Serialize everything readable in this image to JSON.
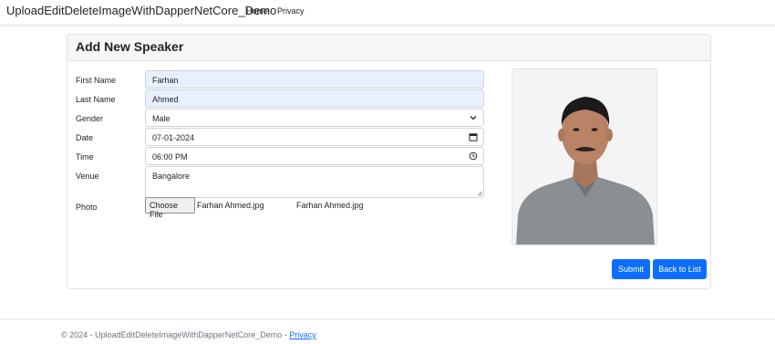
{
  "navbar": {
    "brand": "UploadEditDeleteImageWithDapperNetCore_Demo",
    "links": [
      "Home",
      "Privacy"
    ]
  },
  "card": {
    "title": "Add New Speaker"
  },
  "form": {
    "first_name": {
      "label": "First Name",
      "value": "Farhan"
    },
    "last_name": {
      "label": "Last Name",
      "value": "Ahmed"
    },
    "gender": {
      "label": "Gender",
      "value": "Male"
    },
    "date": {
      "label": "Date",
      "value": "07-01-2024"
    },
    "time": {
      "label": "Time",
      "value": "06:00 PM"
    },
    "venue": {
      "label": "Venue",
      "value": "Bangalore"
    },
    "photo": {
      "label": "Photo",
      "button_label": "Choose File",
      "chosen_file": "Farhan Ahmed.jpg",
      "existing_file": "Farhan Ahmed.jpg"
    }
  },
  "buttons": {
    "submit": "Submit",
    "back": "Back to List"
  },
  "footer": {
    "text": "© 2024 - UploadEditDeleteImageWithDapperNetCore_Demo - ",
    "link": "Privacy"
  },
  "colors": {
    "primary": "#0d6efd",
    "autofill": "#e8f0fe",
    "muted": "#6c757d"
  }
}
